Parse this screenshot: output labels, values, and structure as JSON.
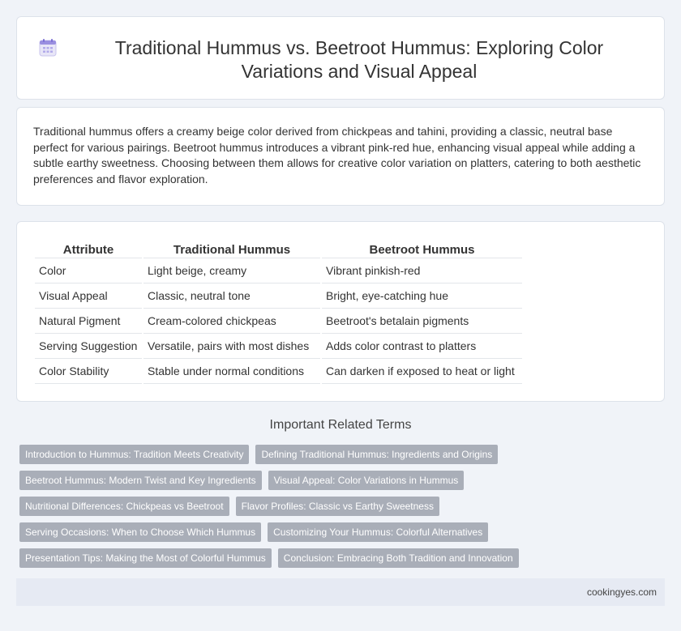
{
  "header": {
    "title": "Traditional Hummus vs. Beetroot Hummus: Exploring Color Variations and Visual Appeal",
    "icon": "calendar-icon"
  },
  "summary": "Traditional hummus offers a creamy beige color derived from chickpeas and tahini, providing a classic, neutral base perfect for various pairings. Beetroot hummus introduces a vibrant pink-red hue, enhancing visual appeal while adding a subtle earthy sweetness. Choosing between them allows for creative color variation on platters, catering to both aesthetic preferences and flavor exploration.",
  "table": {
    "headers": [
      "Attribute",
      "Traditional Hummus",
      "Beetroot Hummus"
    ],
    "rows": [
      [
        "Color",
        "Light beige, creamy",
        "Vibrant pinkish-red"
      ],
      [
        "Visual Appeal",
        "Classic, neutral tone",
        "Bright, eye-catching hue"
      ],
      [
        "Natural Pigment",
        "Cream-colored chickpeas",
        "Beetroot's betalain pigments"
      ],
      [
        "Serving Suggestion",
        "Versatile, pairs with most dishes",
        "Adds color contrast to platters"
      ],
      [
        "Color Stability",
        "Stable under normal conditions",
        "Can darken if exposed to heat or light"
      ]
    ]
  },
  "related": {
    "title": "Important Related Terms",
    "tags": [
      [
        "Introduction to Hummus: Tradition Meets Creativity",
        "Defining Traditional Hummus: Ingredients and Origins"
      ],
      [
        "Beetroot Hummus: Modern Twist and Key Ingredients",
        "Visual Appeal: Color Variations in Hummus"
      ],
      [
        "Nutritional Differences: Chickpeas vs Beetroot",
        "Flavor Profiles: Classic vs Earthy Sweetness"
      ],
      [
        "Serving Occasions: When to Choose Which Hummus",
        "Customizing Your Hummus: Colorful Alternatives"
      ],
      [
        "Presentation Tips: Making the Most of Colorful Hummus",
        "Conclusion: Embracing Both Tradition and Innovation"
      ]
    ]
  },
  "footer": {
    "site": "cookingyes.com"
  }
}
